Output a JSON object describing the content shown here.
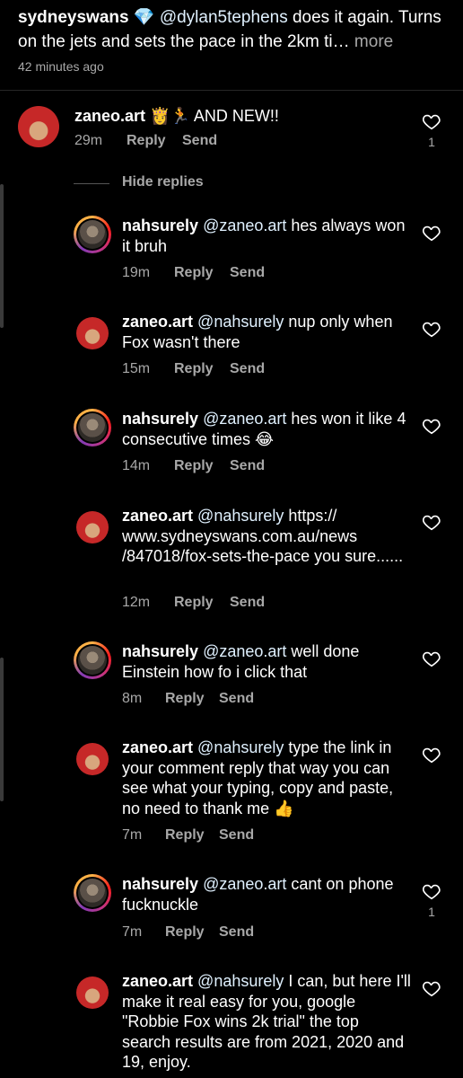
{
  "caption": {
    "username": "sydneyswans",
    "badge": "💎",
    "mention": "@dylan5tephens",
    "text": " does it again. Turns on the jets and sets the pace in the 2km ti",
    "ellipsis": "…",
    "more_label": " more",
    "time": "42 minutes ago"
  },
  "comment": {
    "username": "zaneo.art",
    "text": " 👸🏃 AND NEW!!",
    "time": "29m",
    "reply_label": "Reply",
    "send_label": "Send",
    "likes": "1",
    "hide_replies_label": "Hide replies"
  },
  "replies": [
    {
      "username": "nahsurely",
      "mention": "@zaneo.art",
      "text": " hes always won it bruh",
      "time": "19m",
      "reply_label": "Reply",
      "send_label": "Send",
      "likes": ""
    },
    {
      "username": "zaneo.art",
      "mention": "@nahsurely",
      "text": " nup only when Fox wasn't there",
      "time": "15m",
      "reply_label": "Reply",
      "send_label": "Send",
      "likes": ""
    },
    {
      "username": "nahsurely",
      "mention": "@zaneo.art",
      "text": " hes won it like 4 consecutive times 😂",
      "time": "14m",
      "reply_label": "Reply",
      "send_label": "Send",
      "likes": ""
    },
    {
      "username": "zaneo.art",
      "mention": "@nahsurely",
      "text": " https:// www.sydneyswans.com.au/news /847018/fox-sets-the-pace you sure......",
      "time": "12m",
      "reply_label": "Reply",
      "send_label": "Send",
      "likes": ""
    },
    {
      "username": "nahsurely",
      "mention": "@zaneo.art",
      "text": " well done Einstein how fo i click that",
      "time": "8m",
      "reply_label": "Reply",
      "send_label": "Send",
      "likes": ""
    },
    {
      "username": "zaneo.art",
      "mention": "@nahsurely",
      "text": " type the link in your comment reply that way you can see what your typing, copy and paste, no need to thank me 👍",
      "time": "7m",
      "reply_label": "Reply",
      "send_label": "Send",
      "likes": ""
    },
    {
      "username": "nahsurely",
      "mention": "@zaneo.art",
      "text": " cant on phone fucknuckle",
      "time": "7m",
      "reply_label": "Reply",
      "send_label": "Send",
      "likes": "1"
    },
    {
      "username": "zaneo.art",
      "mention": "@nahsurely",
      "text": " I can,  but here I'll make it real easy for you, google \"Robbie Fox wins 2k trial\" the top search results are from 2021, 2020 and 19, enjoy.",
      "time": "",
      "reply_label": "",
      "send_label": "",
      "likes": ""
    }
  ],
  "colors": {
    "background": "#000000",
    "text": "#ffffff",
    "secondary": "#a8a8a8",
    "mention": "#e0f1ff"
  },
  "icons": [
    "heart-icon"
  ]
}
